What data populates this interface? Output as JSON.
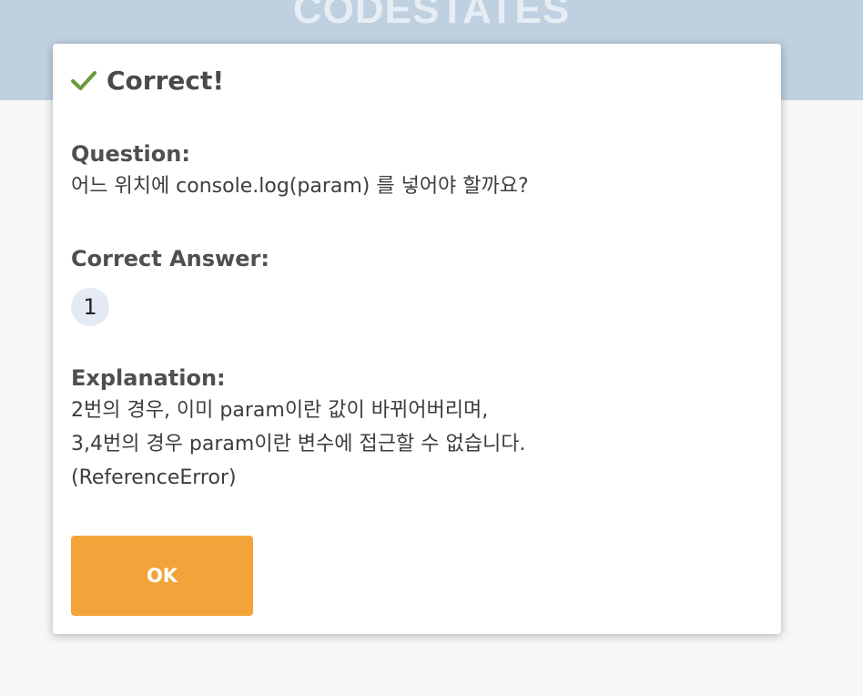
{
  "brand": {
    "logo_text": "CODESTATES"
  },
  "modal": {
    "status_icon": "check-icon",
    "title": "Correct!",
    "question": {
      "label": "Question:",
      "text": "어느 위치에 console.log(param) 를 넣어야 할까요?"
    },
    "answer": {
      "label": "Correct Answer:",
      "value": "1"
    },
    "explanation": {
      "label": "Explanation:",
      "lines": [
        "2번의 경우, 이미 param이란 값이 바뀌어버리며,",
        "3,4번의 경우 param이란 변수에 접근할 수 없습니다.",
        "(ReferenceError)"
      ]
    },
    "ok_label": "OK"
  },
  "colors": {
    "check": "#6a9a3a",
    "ok_button": "#f2a43a",
    "banner": "#bfd0e0",
    "answer_badge": "#e3eaf3"
  }
}
